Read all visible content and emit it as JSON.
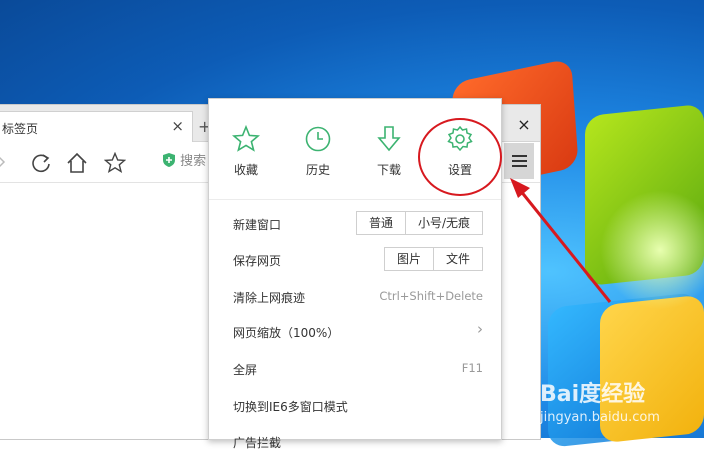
{
  "browser": {
    "tab_title": "标签页",
    "tab_close": "×",
    "new_tab": "+",
    "close": "×",
    "search_label": "搜索"
  },
  "menu": {
    "top_items": [
      {
        "label": "收藏",
        "icon": "star-icon"
      },
      {
        "label": "历史",
        "icon": "clock-icon"
      },
      {
        "label": "下载",
        "icon": "download-icon"
      },
      {
        "label": "设置",
        "icon": "gear-icon"
      }
    ],
    "new_window": {
      "label": "新建窗口",
      "options": [
        "普通",
        "小号/无痕"
      ]
    },
    "save_page": {
      "label": "保存网页",
      "options": [
        "图片",
        "文件"
      ]
    },
    "clear_history": {
      "label": "清除上网痕迹",
      "shortcut": "Ctrl+Shift+Delete"
    },
    "zoom": {
      "label": "网页缩放（100%）",
      "arrow": "›"
    },
    "fullscreen": {
      "label": "全屏",
      "shortcut": "F11"
    },
    "ie6_mode": {
      "label": "切换到IE6多窗口模式"
    },
    "partial": {
      "label": "广告拦截"
    }
  },
  "watermark": {
    "brand": "Bai度经验",
    "url": "jingyan.baidu.com"
  },
  "colors": {
    "accent_green": "#3cb371",
    "annotation_red": "#d7191f"
  }
}
